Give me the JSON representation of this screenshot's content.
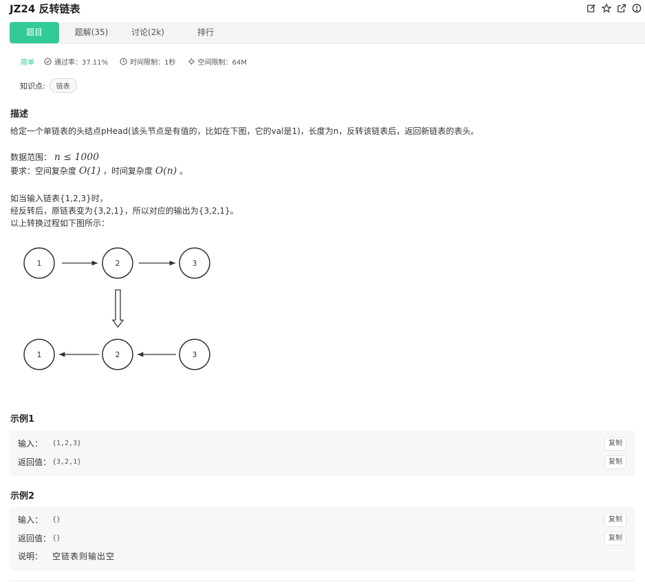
{
  "header": {
    "title": "JZ24  反转链表",
    "icons": [
      "edit-icon",
      "star-icon",
      "share-icon",
      "info-icon"
    ]
  },
  "tabs": [
    {
      "label": "题目",
      "active": true
    },
    {
      "label": "题解(35)",
      "active": false
    },
    {
      "label": "讨论(2k)",
      "active": false
    },
    {
      "label": "排行",
      "active": false
    }
  ],
  "meta": {
    "difficulty": "简单",
    "pass_rate": "通过率：37.11%",
    "time_limit": "时间限制：1秒",
    "space_limit": "空间限制：64M"
  },
  "knowledge": {
    "label": "知识点:",
    "tags": [
      "链表"
    ]
  },
  "description": {
    "heading": "描述",
    "line1": "给定一个单链表的头结点pHead(该头节点是有值的，比如在下图，它的val是1)，长度为n，反转该链表后，返回新链表的表头。",
    "range_label": "数据范围：",
    "range_math": "n ≤ 1000",
    "req_prefix": "要求：空间复杂度 ",
    "req_space": "O(1)",
    "req_mid": " ，时间复杂度 ",
    "req_time": "O(n)",
    "req_suffix": " 。",
    "line4": "如当输入链表{1,2,3}时，",
    "line5": "经反转后，原链表变为{3,2,1}，所以对应的输出为{3,2,1}。",
    "line6": "以上转换过程如下图所示："
  },
  "diagram": {
    "top_nodes": [
      "1",
      "2",
      "3"
    ],
    "bottom_nodes": [
      "1",
      "2",
      "3"
    ]
  },
  "examples": [
    {
      "heading": "示例1",
      "input_label": "输入：",
      "input": "{1,2,3}",
      "output_label": "返回值：",
      "output": "{3,2,1}",
      "copy_label": "复制"
    },
    {
      "heading": "示例2",
      "input_label": "输入：",
      "input": "{}",
      "output_label": "返回值：",
      "output": "{}",
      "explain_label": "说明：",
      "explain": "空链表则输出空",
      "copy_label": "复制"
    }
  ],
  "colors": {
    "accent": "#32ca99",
    "tab_bar": "#f3f4f6",
    "example_bg": "#f6f7f9"
  }
}
